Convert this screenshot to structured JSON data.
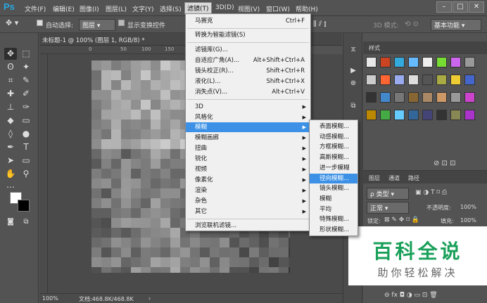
{
  "app": {
    "logo": "Ps"
  },
  "menubar": {
    "items": [
      "文件(F)",
      "编辑(E)",
      "图像(I)",
      "图层(L)",
      "文字(Y)",
      "选择(S)",
      "滤镜(T)",
      "3D(D)",
      "视图(V)",
      "窗口(W)",
      "帮助(H)"
    ],
    "active": "滤镜(T)",
    "window_buttons": [
      "minimize",
      "maximize",
      "close"
    ]
  },
  "options_bar": {
    "auto_select_label": "自动选择:",
    "auto_select_value": "图层",
    "show_transform_label": "显示变换控件",
    "mode3d_label": "3D 模式:",
    "workspace": "基本功能"
  },
  "document": {
    "tab_title": "未标题-1 @ 100% (图层 1, RGB/8) *",
    "ruler_ticks": [
      "0",
      "50",
      "100",
      "150"
    ],
    "zoom": "100%",
    "doc_info": "文档:468.8K/468.8K"
  },
  "filter_menu": {
    "top_items": [
      {
        "label": "马赛克",
        "shortcut": "Ctrl+F"
      },
      {
        "label": "转换为智能滤镜(S)",
        "shortcut": ""
      },
      {
        "label": "滤镜库(G)...",
        "shortcut": ""
      },
      {
        "label": "自适应广角(A)...",
        "shortcut": "Alt+Shift+Ctrl+A"
      },
      {
        "label": "镜头校正(R)...",
        "shortcut": "Shift+Ctrl+R"
      },
      {
        "label": "液化(L)...",
        "shortcut": "Shift+Ctrl+X"
      },
      {
        "label": "消失点(V)...",
        "shortcut": "Alt+Ctrl+V"
      }
    ],
    "sub_items": [
      "3D",
      "风格化",
      "模糊",
      "模糊画廊",
      "扭曲",
      "锐化",
      "视频",
      "像素化",
      "渲染",
      "杂色",
      "其它"
    ],
    "highlighted_sub": "模糊",
    "bottom_item": "浏览联机滤镜..."
  },
  "blur_submenu": {
    "items": [
      "表面模糊...",
      "动感模糊...",
      "方框模糊...",
      "高斯模糊...",
      "进一步模糊",
      "径向模糊...",
      "镜头模糊...",
      "模糊",
      "平均",
      "特殊模糊...",
      "形状模糊..."
    ],
    "highlighted": "径向模糊..."
  },
  "styles_panel": {
    "tab": "样式"
  },
  "layers_panel": {
    "tabs": [
      "图层",
      "通道",
      "路径"
    ],
    "filter_kind": "ρ 类型",
    "blend_mode": "正常",
    "opacity_label": "不透明度:",
    "opacity_value": "100%",
    "lock_label": "锁定:",
    "fill_label": "填充:",
    "fill_value": "100%"
  },
  "watermark": {
    "line1": "百科全说",
    "line2": "助你轻松解决"
  },
  "colors": {
    "accent": "#3c91e6",
    "bg": "#535353",
    "watermark_green": "#1aa05a"
  }
}
